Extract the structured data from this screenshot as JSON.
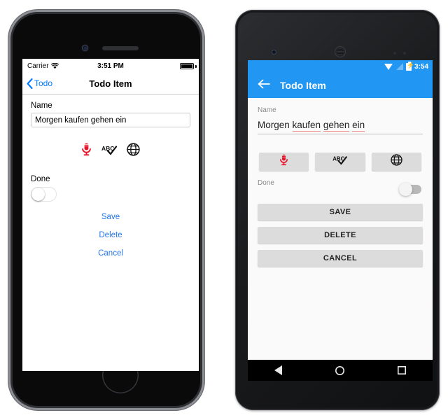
{
  "iphone": {
    "status": {
      "carrier": "Carrier",
      "wifi_icon": "wifi-icon",
      "time": "3:51 PM",
      "battery_icon": "battery-icon"
    },
    "nav": {
      "back_label": "Todo",
      "back_icon": "chevron-left-icon",
      "title": "Todo Item"
    },
    "form": {
      "name_label": "Name",
      "name_value": "Morgen kaufen gehen ein",
      "name_placeholder": "Name",
      "done_label": "Done",
      "toggle_state": "off"
    },
    "icons": [
      {
        "name": "microphone-icon",
        "label": "Speech input",
        "color": "#e8142a"
      },
      {
        "name": "spellcheck-icon",
        "label": "Spell check",
        "color": "#111111"
      },
      {
        "name": "globe-icon",
        "label": "Translate",
        "color": "#111111"
      }
    ],
    "actions": [
      {
        "name": "save-button",
        "label": "Save"
      },
      {
        "name": "delete-button",
        "label": "Delete"
      },
      {
        "name": "cancel-button",
        "label": "Cancel"
      }
    ],
    "hardware": {
      "camera": "front-camera",
      "speaker": "earpiece-speaker",
      "home": "home-button"
    }
  },
  "android": {
    "status": {
      "wifi_icon": "wifi-icon",
      "signal_icon": "signal-icon",
      "battery_icon": "battery-charging-icon",
      "time": "3:54"
    },
    "appbar": {
      "back_icon": "arrow-back-icon",
      "title": "Todo Item"
    },
    "form": {
      "name_label": "Name",
      "name_words": [
        "Morgen ",
        "kaufen",
        " ",
        "gehen",
        " ",
        "ein"
      ],
      "misspelled": [
        "kaufen",
        "gehen",
        "ein"
      ],
      "done_label": "Done",
      "toggle_state": "off"
    },
    "icons": [
      {
        "name": "microphone-icon",
        "label": "Speech input",
        "color": "#e8142a"
      },
      {
        "name": "spellcheck-icon",
        "label": "Spell check",
        "color": "#111111"
      },
      {
        "name": "globe-icon",
        "label": "Translate",
        "color": "#111111"
      }
    ],
    "actions": [
      {
        "name": "save-button",
        "label": "SAVE"
      },
      {
        "name": "delete-button",
        "label": "DELETE"
      },
      {
        "name": "cancel-button",
        "label": "CANCEL"
      }
    ],
    "navbar": [
      {
        "name": "nav-back-button",
        "icon": "triangle-back-icon"
      },
      {
        "name": "nav-home-button",
        "icon": "circle-home-icon"
      },
      {
        "name": "nav-recents-button",
        "icon": "square-recents-icon"
      }
    ],
    "hardware": {
      "camera": "front-camera",
      "speaker": "earpiece-speaker",
      "sensors": "proximity-sensors"
    }
  },
  "theme": {
    "ios_accent": "#007aff",
    "ios_link": "#2277ee",
    "android_primary": "#2196f3",
    "android_button": "#dcdcdc",
    "spell_underline": "#f08a8a"
  }
}
